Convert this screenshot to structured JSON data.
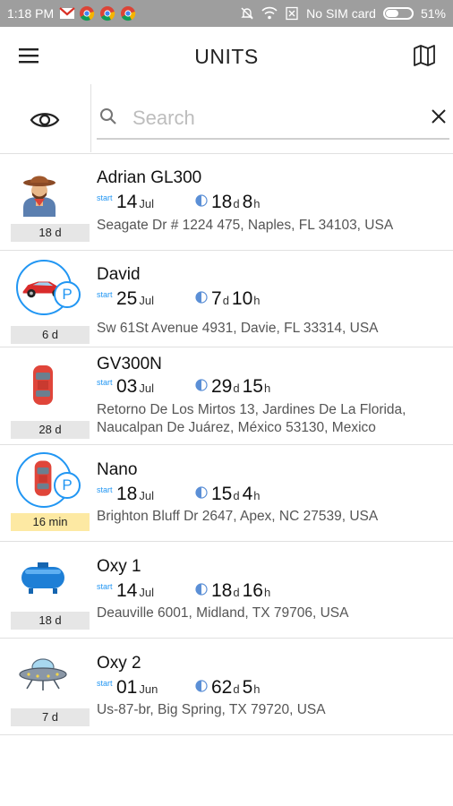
{
  "status_bar": {
    "time": "1:18 PM",
    "notification_icons": [
      "gmail-icon",
      "chrome-icon",
      "chrome-icon",
      "chrome-icon"
    ],
    "right_icons": [
      "bell-off-icon",
      "wifi-icon",
      "no-sim-icon"
    ],
    "carrier": "No SIM card",
    "battery": "51%"
  },
  "app_bar": {
    "title": "UNITS",
    "menu_icon": "hamburger-menu-icon",
    "map_icon": "map-icon"
  },
  "search": {
    "placeholder": "Search",
    "value": "",
    "visibility_icon": "eye-icon",
    "search_icon": "search-icon",
    "clear_icon": "close-icon"
  },
  "colors": {
    "accent": "#2196f3",
    "status_bar": "#9e9e9e",
    "age_badge": "#e6e6e6",
    "age_badge_warning": "#fde9a3"
  },
  "units": [
    {
      "name": "Adrian GL300",
      "icon": "cowboy-avatar-icon",
      "parked": false,
      "age": "18 d",
      "start_label": "start",
      "start_day": "14",
      "start_month": "Jul",
      "duration_days": "18",
      "duration_days_unit": "d",
      "duration_hours": "8",
      "duration_hours_unit": "h",
      "address": "Seagate Dr # 1224 475, Naples, FL 34103, USA"
    },
    {
      "name": "David",
      "icon": "red-sports-car-icon",
      "parked": true,
      "parked_label": "P",
      "age": "6 d",
      "start_label": "start",
      "start_day": "25",
      "start_month": "Jul",
      "duration_days": "7",
      "duration_days_unit": "d",
      "duration_hours": "10",
      "duration_hours_unit": "h",
      "address": "Sw 61St Avenue 4931, Davie, FL 33314, USA"
    },
    {
      "name": "GV300N",
      "icon": "red-car-top-view-icon",
      "parked": false,
      "age": "28 d",
      "start_label": "start",
      "start_day": "03",
      "start_month": "Jul",
      "duration_days": "29",
      "duration_days_unit": "d",
      "duration_hours": "15",
      "duration_hours_unit": "h",
      "address": "Retorno De Los Mirtos 13, Jardines De La Florida, Naucalpan De Juárez, México 53130, Mexico"
    },
    {
      "name": "Nano",
      "icon": "red-car-top-view-icon",
      "parked": true,
      "parked_label": "P",
      "age": "16 min",
      "age_warning": true,
      "start_label": "start",
      "start_day": "18",
      "start_month": "Jul",
      "duration_days": "15",
      "duration_days_unit": "d",
      "duration_hours": "4",
      "duration_hours_unit": "h",
      "address": "Brighton Bluff Dr 2647, Apex, NC 27539, USA"
    },
    {
      "name": "Oxy 1",
      "icon": "blue-tank-icon",
      "parked": false,
      "age": "18 d",
      "start_label": "start",
      "start_day": "14",
      "start_month": "Jul",
      "duration_days": "18",
      "duration_days_unit": "d",
      "duration_hours": "16",
      "duration_hours_unit": "h",
      "address": "Deauville 6001, Midland, TX 79706, USA"
    },
    {
      "name": "Oxy 2",
      "icon": "ufo-icon",
      "parked": false,
      "age": "7 d",
      "start_label": "start",
      "start_day": "01",
      "start_month": "Jun",
      "duration_days": "62",
      "duration_days_unit": "d",
      "duration_hours": "5",
      "duration_hours_unit": "h",
      "address": "Us-87-br, Big Spring, TX 79720, USA"
    }
  ]
}
